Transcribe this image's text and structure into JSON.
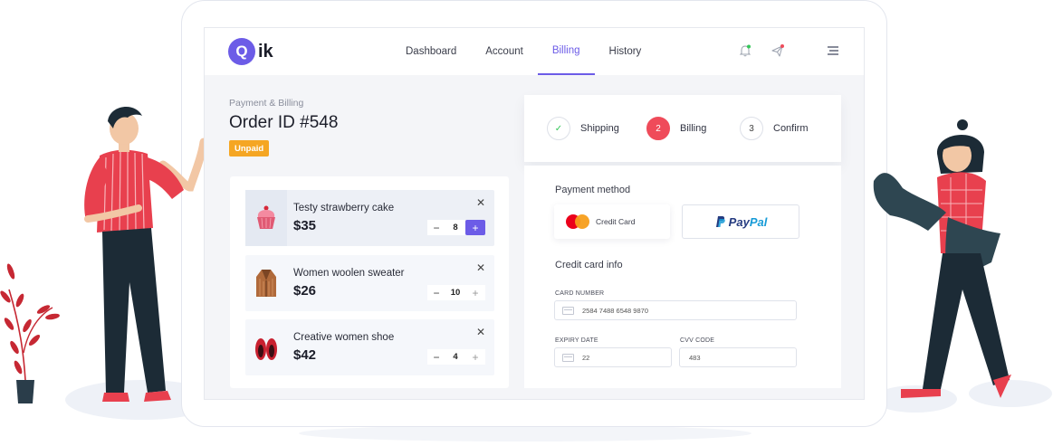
{
  "app": {
    "logo_letter": "Q",
    "logo_rest": "ik"
  },
  "nav": {
    "items": [
      {
        "label": "Dashboard"
      },
      {
        "label": "Account"
      },
      {
        "label": "Billing",
        "active": true
      },
      {
        "label": "History"
      }
    ]
  },
  "page": {
    "breadcrumb": "Payment & Billing",
    "order_id": "Order ID #548",
    "status_badge": "Unpaid"
  },
  "cart": {
    "items": [
      {
        "name": "Testy strawberry cake",
        "price": "$35",
        "qty": "8",
        "icon": "cupcake-icon"
      },
      {
        "name": "Women woolen sweater",
        "price": "$26",
        "qty": "10",
        "icon": "sweater-icon"
      },
      {
        "name": "Creative women shoe",
        "price": "$42",
        "qty": "4",
        "icon": "shoe-icon"
      }
    ]
  },
  "steps": [
    {
      "label": "Shipping",
      "marker": "✓",
      "state": "done"
    },
    {
      "label": "Billing",
      "marker": "2",
      "state": "active"
    },
    {
      "label": "Confirm",
      "marker": "3",
      "state": "pending"
    }
  ],
  "payment": {
    "method_title": "Payment method",
    "credit_card_label": "Credit Card",
    "paypal_a": "Pay",
    "paypal_b": "Pal",
    "card_info_title": "Credit card info",
    "card_number_label": "CARD NUMBER",
    "card_number_value": "2584  7488  6548  9870",
    "expiry_label": "EXPIRY DATE",
    "expiry_value": "22",
    "cvv_label": "CVV CODE",
    "cvv_value": "483"
  },
  "colors": {
    "accent": "#6c5ce7",
    "step_active": "#ef4b5a",
    "badge": "#f5a623",
    "notif_dot": "#34c759",
    "send_dot": "#ef4b5a"
  }
}
